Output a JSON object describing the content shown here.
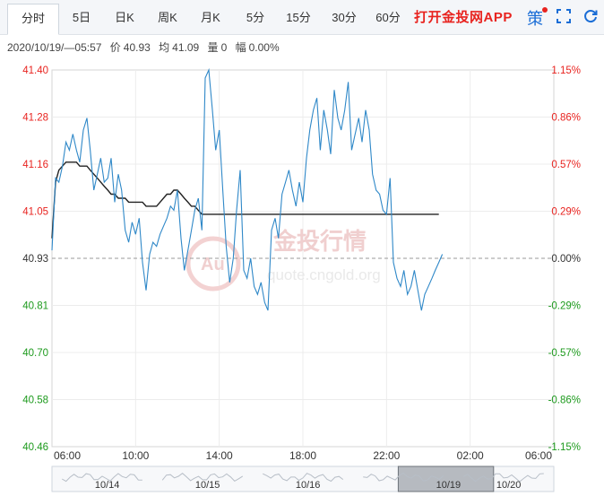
{
  "tabs": [
    "分时",
    "5日",
    "日K",
    "周K",
    "月K",
    "5分",
    "15分",
    "30分",
    "60分"
  ],
  "active_tab": "分时",
  "promo_text": "打开金投网APP",
  "strategy_label": "策",
  "info": {
    "datetime": "2020/10/19/—05:57",
    "price_label": "价",
    "price": "40.93",
    "avg_label": "均",
    "avg": "41.09",
    "volume_label": "量",
    "volume": "0",
    "change_label": "幅",
    "change": "0.00%"
  },
  "watermark": {
    "cn": "金投行情",
    "en": "quote.cngold.org",
    "logo": "Au"
  },
  "colors": {
    "up": "#e8231f",
    "down": "#1d9a1d",
    "flat": "#333333",
    "price_line": "#2f88c8",
    "avg_line": "#222222",
    "accent": "#1a6dd6"
  },
  "chart_data": {
    "type": "line",
    "y_ticks": [
      "41.40",
      "41.28",
      "41.16",
      "41.05",
      "40.93",
      "40.81",
      "40.70",
      "40.58",
      "40.46"
    ],
    "pct_ticks": [
      "1.15%",
      "0.86%",
      "0.57%",
      "0.29%",
      "0.00%",
      "-0.29%",
      "-0.57%",
      "-0.86%",
      "-1.15%"
    ],
    "ylim": [
      40.46,
      41.4
    ],
    "baseline": 40.93,
    "x_ticks": [
      "06:00",
      "10:00",
      "14:00",
      "18:00",
      "22:00",
      "02:00",
      "06:00"
    ],
    "x_range_hours": [
      0,
      24
    ],
    "series": [
      {
        "values_x_hours": [
          0,
          0.17,
          0.33,
          0.5,
          0.67,
          0.83,
          1,
          1.17,
          1.33,
          1.5,
          1.67,
          1.83,
          2,
          2.17,
          2.33,
          2.5,
          2.67,
          2.83,
          3,
          3.17,
          3.33,
          3.5,
          3.67,
          3.83,
          4,
          4.17,
          4.33,
          4.5,
          4.67,
          4.83,
          5,
          5.17,
          5.33,
          5.5,
          5.67,
          5.83,
          6,
          6.17,
          6.33,
          6.5,
          6.67,
          6.83,
          7,
          7.17,
          7.33,
          7.5,
          7.67,
          7.83,
          8,
          8.17,
          8.33,
          8.5,
          8.67,
          8.83,
          9,
          9.17,
          9.33,
          9.5,
          9.67,
          9.83,
          10,
          10.17,
          10.33,
          10.5,
          10.67,
          10.83,
          11,
          11.17,
          11.33,
          11.5,
          11.67,
          11.83,
          12,
          12.17,
          12.33,
          12.5,
          12.67,
          12.83,
          13,
          13.17,
          13.33,
          13.5,
          13.67,
          13.83,
          14,
          14.17,
          14.33,
          14.5,
          14.67,
          14.83,
          15,
          15.17,
          15.33,
          15.5,
          15.67,
          15.83,
          16,
          16.17,
          16.33,
          16.5,
          16.67,
          16.83,
          17,
          17.17,
          17.33,
          17.5,
          17.67,
          17.83,
          18,
          18.17,
          18.33,
          18.5,
          18.67,
          18.83,
          19,
          19.17,
          19.33,
          19.5,
          19.67,
          19.83,
          20,
          20.17,
          20.33,
          20.5,
          20.67,
          20.83,
          21,
          21.17,
          21.33,
          21.5,
          21.67,
          21.83,
          22,
          22.17,
          22.33,
          22.5,
          22.67,
          22.83,
          23,
          23.17,
          23.33,
          23.5,
          23.67,
          23.83
        ],
        "price": [
          40.95,
          41.13,
          41.12,
          41.16,
          41.22,
          41.2,
          41.24,
          41.2,
          41.17,
          41.25,
          41.28,
          41.2,
          41.1,
          41.14,
          41.18,
          41.12,
          41.13,
          41.18,
          41.07,
          41.14,
          41.1,
          41.0,
          40.97,
          41.02,
          40.99,
          41.03,
          40.92,
          40.85,
          40.94,
          40.97,
          40.96,
          40.99,
          41.01,
          41.03,
          41.06,
          41.05,
          41.1,
          40.98,
          40.9,
          40.95,
          41.0,
          41.05,
          41.08,
          41.0,
          41.38,
          41.4,
          41.3,
          41.2,
          41.25,
          41.1,
          40.96,
          40.87,
          40.93,
          41.05,
          41.15,
          40.9,
          40.88,
          40.93,
          40.86,
          40.84,
          40.87,
          40.82,
          40.8,
          41.0,
          41.03,
          40.98,
          41.09,
          41.12,
          41.15,
          41.1,
          41.06,
          41.12,
          41.07,
          41.18,
          41.25,
          41.3,
          41.33,
          41.2,
          41.3,
          41.25,
          41.19,
          41.35,
          41.28,
          41.25,
          41.3,
          41.37,
          41.2,
          41.24,
          41.28,
          41.22,
          41.3,
          41.25,
          41.14,
          41.1,
          41.09,
          41.05,
          41.04,
          41.13,
          40.92,
          40.88,
          40.86,
          40.9,
          40.84,
          40.86,
          40.9,
          40.85,
          40.8,
          40.84,
          40.86,
          40.88,
          40.9,
          40.92,
          40.94
        ],
        "avg": [
          40.98,
          41.12,
          41.15,
          41.16,
          41.17,
          41.17,
          41.17,
          41.17,
          41.16,
          41.16,
          41.16,
          41.15,
          41.14,
          41.13,
          41.12,
          41.11,
          41.1,
          41.09,
          41.09,
          41.08,
          41.08,
          41.08,
          41.07,
          41.07,
          41.07,
          41.07,
          41.07,
          41.06,
          41.06,
          41.06,
          41.06,
          41.07,
          41.08,
          41.09,
          41.09,
          41.1,
          41.1,
          41.09,
          41.08,
          41.07,
          41.06,
          41.06,
          41.05,
          41.04,
          41.04,
          41.04,
          41.04,
          41.04,
          41.04,
          41.04,
          41.04,
          41.04,
          41.04,
          41.04,
          41.04,
          41.04,
          41.04,
          41.04,
          41.04,
          41.04,
          41.04,
          41.04,
          41.04,
          41.04,
          41.04,
          41.04,
          41.04,
          41.04,
          41.04,
          41.04,
          41.04,
          41.04,
          41.04,
          41.04,
          41.04,
          41.04,
          41.04,
          41.04,
          41.04,
          41.04,
          41.04,
          41.04,
          41.04,
          41.04,
          41.04,
          41.04,
          41.04,
          41.04,
          41.04,
          41.04,
          41.04,
          41.04,
          41.04,
          41.04,
          41.04,
          41.04,
          41.04,
          41.04,
          41.04,
          41.04,
          41.04,
          41.04,
          41.04,
          41.04,
          41.04,
          41.04,
          41.04,
          41.04,
          41.04,
          41.04,
          41.04,
          41.04
        ]
      }
    ],
    "navigator": {
      "dates": [
        "10/14",
        "10/15",
        "10/16",
        "10/19",
        "10/20"
      ],
      "selected": "10/19"
    }
  }
}
